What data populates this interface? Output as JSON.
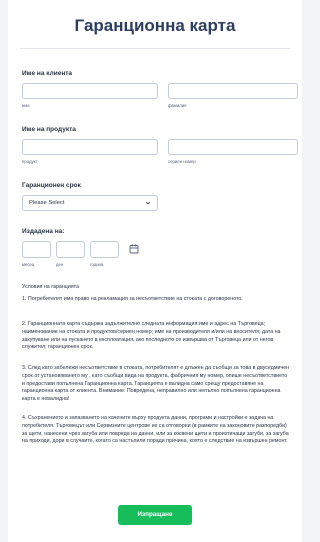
{
  "form": {
    "title": "Гаранционна карта",
    "client": {
      "label": "Име на клиента",
      "first_sublabel": "име",
      "last_sublabel": "фамилия"
    },
    "product": {
      "label": "Име на продукта",
      "product_sublabel": "продукт",
      "serial_sublabel": "сериен номер"
    },
    "warranty": {
      "label": "Гаранционен срок",
      "selected": "Please Select"
    },
    "issued": {
      "label": "Издадена на:",
      "month_sublabel": "месец",
      "day_sublabel": "ден",
      "year_sublabel": "година"
    },
    "terms": {
      "heading": "Условия на гаранцията",
      "p1": "1. Потребителят има право на рекламация за несъответствие на стоката с договореното.",
      "p2": "2. Гаранционната карта съдържа задължително следната информация:име и адрес на Търговеца; наименование на стоката и продуктов/сериен номер; име на производителя и/или на вносителя; дата на закупуване или на пускането в експлоатация, ако последното се извършва от Търговеца или от негов служител; гаранционен срок.",
      "p3": "3. След като забележи несъответствие в стоката, потребителят е длъжен да съобщи за това в двуседмичен срок от установяването му , като съобщи вида на продукта, фабричния му номер, опише несъответствието и предостави попълнена Гаранционна карта. Гаранцията е валидна само срещу предоставяне на гаранционна карта от клиента. Внимание: Повредена, неправилно или непълно попълнена гаранционна карта е невалидна!",
      "p4": "4. Съхранението и запазването на качените върху продукта данни, програми и настройки е задача на потребителя. Търговецът или Сервизните центрове не са отговорни (в рамките на законовите разпоредби) за щети, нанесени чрез загуба или повреда на данни, или за косвени щети и произтичащи загуби, за загуба на приходи, дори в случаите, когато са настъпили поради причина, която е следствие на извършен ремонт."
    },
    "submit_label": "Изпращане"
  },
  "colors": {
    "title": "#2e3e60",
    "submit": "#18bd5b",
    "border": "#c3cad8"
  },
  "icons": {
    "select_arrow": "chevron-down-icon",
    "date_picker": "calendar-icon"
  }
}
